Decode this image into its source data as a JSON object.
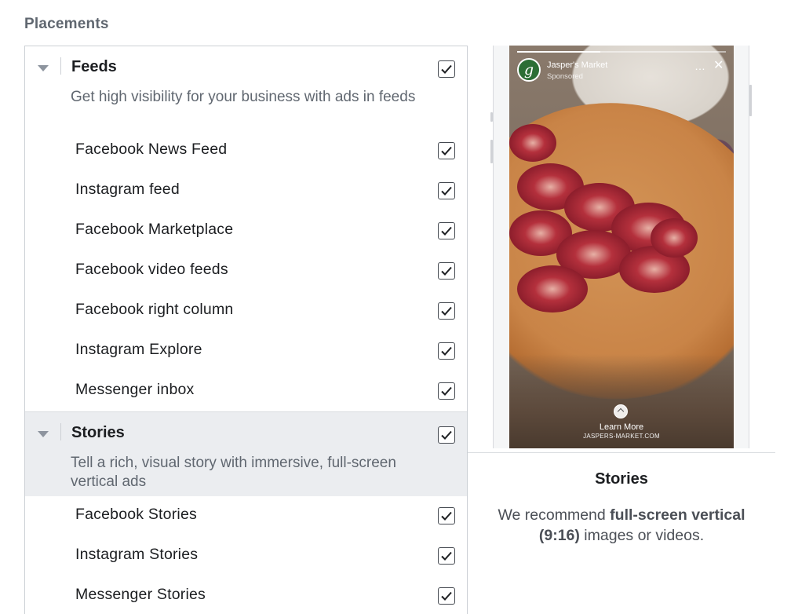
{
  "placements_heading": "Placements",
  "groups": [
    {
      "title": "Feeds",
      "description": "Get high visibility for your business with ads in feeds",
      "checked": true,
      "items": [
        {
          "label": "Facebook News Feed",
          "checked": true
        },
        {
          "label": "Instagram feed",
          "checked": true
        },
        {
          "label": "Facebook Marketplace",
          "checked": true
        },
        {
          "label": "Facebook video feeds",
          "checked": true
        },
        {
          "label": "Facebook right column",
          "checked": true
        },
        {
          "label": "Instagram Explore",
          "checked": true
        },
        {
          "label": "Messenger inbox",
          "checked": true
        }
      ]
    },
    {
      "title": "Stories",
      "description": "Tell a rich, visual story with immersive, full-screen vertical ads",
      "checked": true,
      "items": [
        {
          "label": "Facebook Stories",
          "checked": true
        },
        {
          "label": "Instagram Stories",
          "checked": true
        },
        {
          "label": "Messenger Stories",
          "checked": true
        }
      ]
    }
  ],
  "preview": {
    "brand_name": "Jasper's Market",
    "brand_initial": "g",
    "sponsored": "Sponsored",
    "more_icon": "…",
    "close_icon": "✕",
    "cta": "Learn More",
    "url": "JASPERS-MARKET.COM",
    "title": "Stories",
    "desc_pre": "We recommend ",
    "desc_bold": "full-screen vertical (9:16)",
    "desc_post": " images or videos."
  },
  "icons": {
    "caret": "caret-down-icon",
    "check": "checkmark-icon",
    "avatar_color": "#2c6e35"
  }
}
